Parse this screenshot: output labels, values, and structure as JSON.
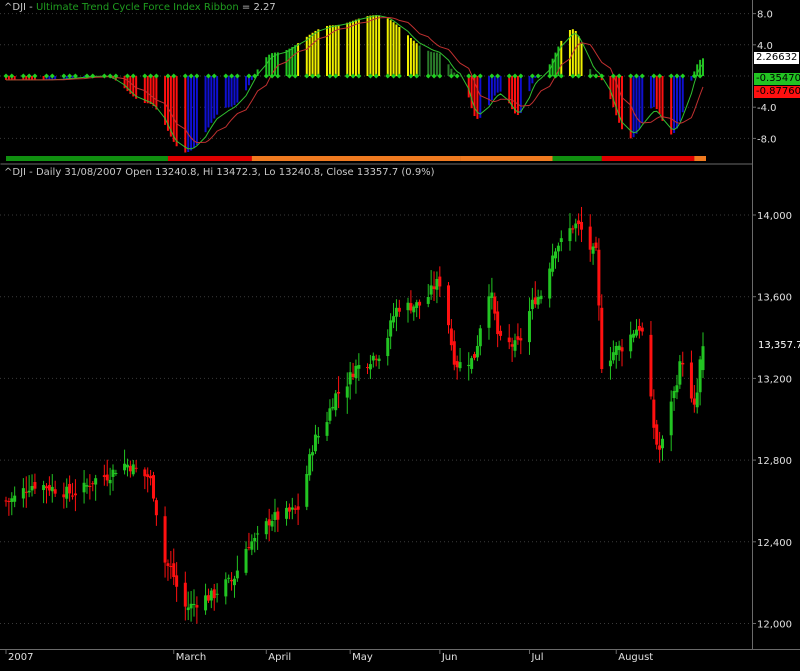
{
  "colors": {
    "background": "#000000",
    "grid": "#3a3a3a",
    "panel_border": "#6a6a6a",
    "up": "#22c422",
    "down": "#ff1010",
    "blue": "#1010d0",
    "yellow": "#f0f000",
    "dark_green": "#2a7a2a",
    "ribbon_green": "#109010",
    "ribbon_red": "#e00000",
    "ribbon_orange": "#f07a20",
    "axis_text": "#e0e0e0",
    "title_green": "#1f9d1f"
  },
  "indicator": {
    "symbol": "^DJI",
    "separator": " - ",
    "name": "Ultimate Trend Cycle Force Index Ribbon",
    "value_text": " = 2.27",
    "y_ticks": [
      "8.0",
      "4.0",
      "-4.0",
      "-8.0"
    ],
    "value_boxes": [
      {
        "text": "2.26632",
        "value": 2.27,
        "bg": "#ffffff",
        "fg": "#000000"
      },
      {
        "text": "-0.354706",
        "value": -0.35,
        "bg": "#22c422",
        "fg": "#000000"
      },
      {
        "text": "-0.877608",
        "value": -2.0,
        "bg": "#ff1010",
        "fg": "#000000"
      }
    ]
  },
  "price": {
    "title": "^DJI - Daily 31/08/2007 Open 13240.8, Hi 13472.3, Lo 13240.8, Close 13357.7 (0.9%)",
    "y_ticks": [
      "14,000",
      "13,600",
      "13,200",
      "12,800",
      "12,400",
      "12,000"
    ],
    "last_price_text": "13,357.7"
  },
  "x_axis": {
    "labels": [
      "2007",
      "March",
      "April",
      "May",
      "Jun",
      "Jul",
      "August"
    ]
  },
  "chart_data": [
    {
      "type": "bar",
      "title": "^DJI - Ultimate Trend Cycle Force Index Ribbon = 2.27",
      "ylim": [
        -10.5,
        9.5
      ],
      "grid": true,
      "oscillator_key_points": [
        {
          "date": "2007-01-15",
          "value": -0.5
        },
        {
          "date": "2007-02-05",
          "value": 0.0
        },
        {
          "date": "2007-02-20",
          "value": -3.5
        },
        {
          "date": "2007-03-05",
          "value": -9.8
        },
        {
          "date": "2007-03-20",
          "value": -4.0
        },
        {
          "date": "2007-04-05",
          "value": 3.0
        },
        {
          "date": "2007-04-25",
          "value": 6.5
        },
        {
          "date": "2007-05-10",
          "value": 7.8
        },
        {
          "date": "2007-05-31",
          "value": 3.0
        },
        {
          "date": "2007-06-08",
          "value": 0.0
        },
        {
          "date": "2007-06-14",
          "value": -5.5
        },
        {
          "date": "2007-06-22",
          "value": -2.0
        },
        {
          "date": "2007-06-28",
          "value": -5.0
        },
        {
          "date": "2007-07-05",
          "value": 0.0
        },
        {
          "date": "2007-07-17",
          "value": 6.0
        },
        {
          "date": "2007-07-25",
          "value": 0.0
        },
        {
          "date": "2007-08-06",
          "value": -8.0
        },
        {
          "date": "2007-08-14",
          "value": -4.0
        },
        {
          "date": "2007-08-20",
          "value": -7.5
        },
        {
          "date": "2007-08-31",
          "value": 2.27
        }
      ],
      "ribbon_segments": [
        {
          "from": "2007-01-02",
          "to": "2007-02-26",
          "color": "green"
        },
        {
          "from": "2007-02-27",
          "to": "2007-03-27",
          "color": "red"
        },
        {
          "from": "2007-03-28",
          "to": "2007-06-07",
          "color": "orange"
        },
        {
          "from": "2007-06-08",
          "to": "2007-07-09",
          "color": "orange"
        },
        {
          "from": "2007-07-10",
          "to": "2007-07-26",
          "color": "green"
        },
        {
          "from": "2007-07-27",
          "to": "2007-08-27",
          "color": "red"
        },
        {
          "from": "2007-08-28",
          "to": "2007-08-31",
          "color": "orange"
        }
      ]
    },
    {
      "type": "candlestick",
      "title": "^DJI - Daily 31/08/2007 Open 13240.8, Hi 13472.3, Lo 13240.8, Close 13357.7 (0.9%)",
      "xlabel": "",
      "ylabel": "",
      "ylim": [
        11950,
        14250
      ],
      "x_range": [
        "2007-01-02",
        "2007-08-31"
      ],
      "grid": true,
      "last": {
        "date": "2007-08-31",
        "open": 13240.8,
        "high": 13472.3,
        "low": 13240.8,
        "close": 13357.7
      },
      "close_key_points": [
        {
          "date": "2007-01-02",
          "value": 12600
        },
        {
          "date": "2007-01-12",
          "value": 12680
        },
        {
          "date": "2007-01-25",
          "value": 12640
        },
        {
          "date": "2007-02-05",
          "value": 12720
        },
        {
          "date": "2007-02-12",
          "value": 12780
        },
        {
          "date": "2007-02-20",
          "value": 12720
        },
        {
          "date": "2007-02-27",
          "value": 12280
        },
        {
          "date": "2007-03-05",
          "value": 12080
        },
        {
          "date": "2007-03-13",
          "value": 12130
        },
        {
          "date": "2007-03-20",
          "value": 12200
        },
        {
          "date": "2007-03-28",
          "value": 12400
        },
        {
          "date": "2007-04-05",
          "value": 12520
        },
        {
          "date": "2007-04-12",
          "value": 12550
        },
        {
          "date": "2007-04-20",
          "value": 12920
        },
        {
          "date": "2007-04-27",
          "value": 13130
        },
        {
          "date": "2007-05-04",
          "value": 13260
        },
        {
          "date": "2007-05-11",
          "value": 13320
        },
        {
          "date": "2007-05-18",
          "value": 13550
        },
        {
          "date": "2007-05-25",
          "value": 13560
        },
        {
          "date": "2007-06-01",
          "value": 13670
        },
        {
          "date": "2007-06-07",
          "value": 13270
        },
        {
          "date": "2007-06-12",
          "value": 13290
        },
        {
          "date": "2007-06-18",
          "value": 13630
        },
        {
          "date": "2007-06-22",
          "value": 13380
        },
        {
          "date": "2007-06-27",
          "value": 13360
        },
        {
          "date": "2007-07-05",
          "value": 13600
        },
        {
          "date": "2007-07-12",
          "value": 13860
        },
        {
          "date": "2007-07-18",
          "value": 13950
        },
        {
          "date": "2007-07-25",
          "value": 13810
        },
        {
          "date": "2007-07-27",
          "value": 13270
        },
        {
          "date": "2007-08-02",
          "value": 13350
        },
        {
          "date": "2007-08-09",
          "value": 13450
        },
        {
          "date": "2007-08-16",
          "value": 12850
        },
        {
          "date": "2007-08-20",
          "value": 13100
        },
        {
          "date": "2007-08-24",
          "value": 13290
        },
        {
          "date": "2007-08-28",
          "value": 13050
        },
        {
          "date": "2007-08-31",
          "value": 13357.7
        }
      ]
    }
  ]
}
